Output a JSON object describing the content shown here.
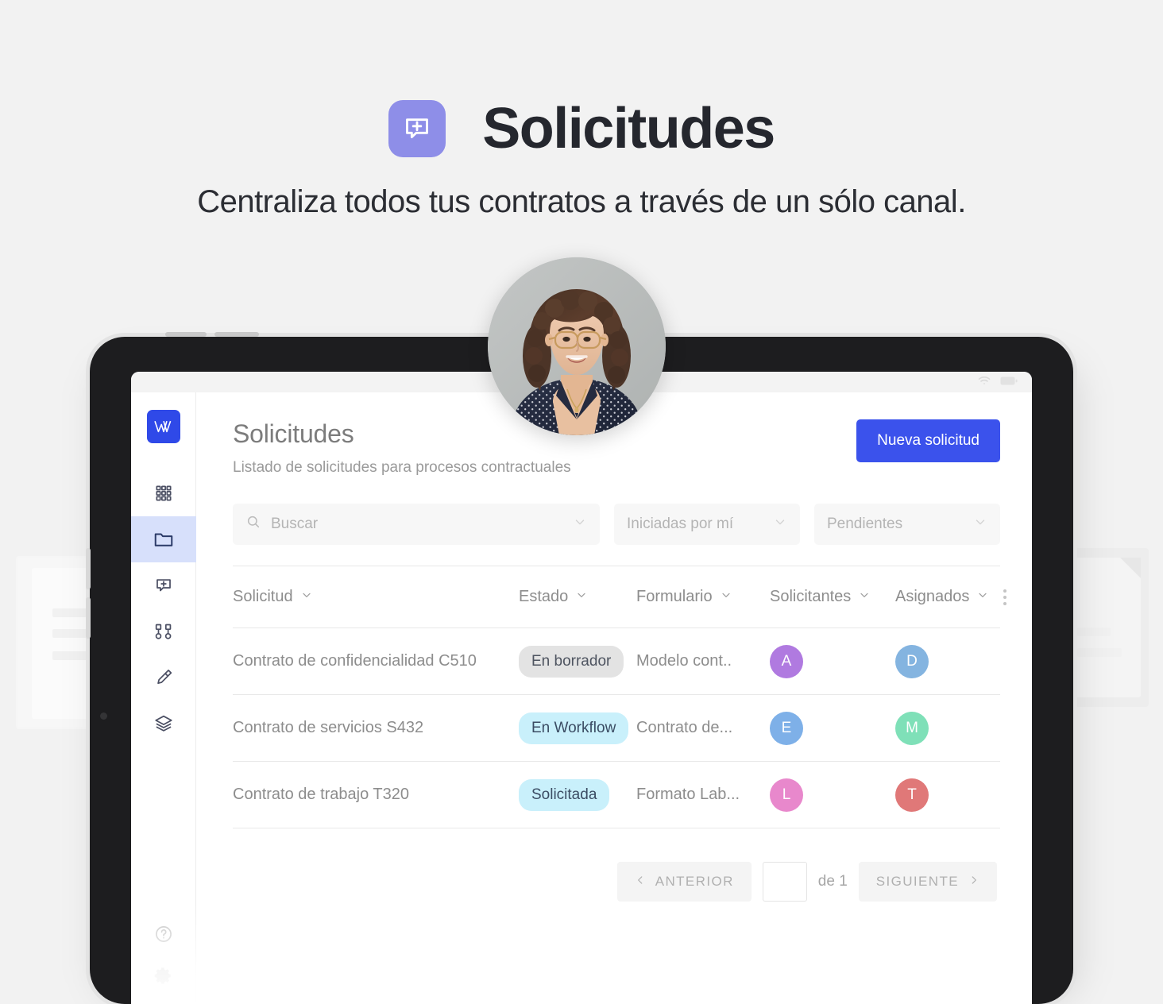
{
  "hero": {
    "badge_icon": "chat-plus-icon",
    "title": "Solicitudes",
    "subtitle": "Centraliza todos tus contratos a través de un sólo canal.",
    "badge_color": "#8e8ee8"
  },
  "app": {
    "sidebar": {
      "logo_label": "W",
      "items": [
        {
          "name": "apps-grid-icon",
          "active": false
        },
        {
          "name": "folder-icon",
          "active": true
        },
        {
          "name": "chat-plus-icon",
          "active": false
        },
        {
          "name": "workflow-nodes-icon",
          "active": false
        },
        {
          "name": "pencil-icon",
          "active": false
        },
        {
          "name": "layers-icon",
          "active": false
        }
      ],
      "bottom_items": [
        {
          "name": "help-circle-icon"
        },
        {
          "name": "gear-icon"
        }
      ]
    },
    "header": {
      "title": "Solicitudes",
      "subtitle": "Listado de solicitudes para procesos contractuales",
      "new_request_label": "Nueva solicitud",
      "accent_color": "#3b52ec"
    },
    "filters": {
      "search_placeholder": "Buscar",
      "select_started_by": "Iniciadas por mí",
      "select_status": "Pendientes"
    },
    "table": {
      "columns": [
        {
          "label": "Solicitud"
        },
        {
          "label": "Estado"
        },
        {
          "label": "Formulario"
        },
        {
          "label": "Solicitantes"
        },
        {
          "label": "Asignados"
        }
      ],
      "rows": [
        {
          "solicitud": "Contrato de confidencialidad C510",
          "estado": "En borrador",
          "estado_style": "badge-draft",
          "formulario": "Modelo cont..",
          "solicitante_initial": "A",
          "solicitante_color": "#b07ae0",
          "asignado_initial": "D",
          "asignado_color": "#84b4e0"
        },
        {
          "solicitud": "Contrato de servicios S432",
          "estado": "En Workflow",
          "estado_style": "badge-workflow",
          "formulario": "Contrato de...",
          "solicitante_initial": "E",
          "solicitante_color": "#7eb0e8",
          "asignado_initial": "M",
          "asignado_color": "#7fe0b8"
        },
        {
          "solicitud": "Contrato de trabajo T320",
          "estado": "Solicitada",
          "estado_style": "badge-requested",
          "formulario": "Formato Lab...",
          "solicitante_initial": "L",
          "solicitante_color": "#e888cc",
          "asignado_initial": "T",
          "asignado_color": "#e07878"
        }
      ]
    },
    "pagination": {
      "prev_label": "ANTERIOR",
      "page_value": "",
      "of_label": "de 1",
      "next_label": "SIGUIENTE"
    }
  }
}
